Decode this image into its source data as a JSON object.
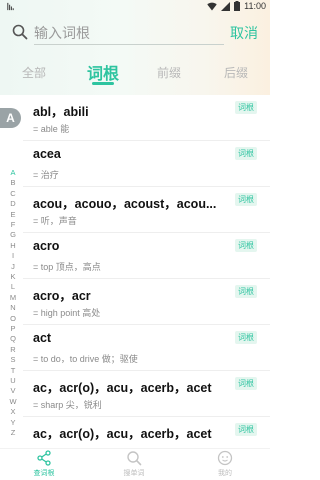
{
  "status_bar": {
    "time": "11:00"
  },
  "search": {
    "placeholder": "输入词根",
    "cancel_label": "取消"
  },
  "tabs": [
    {
      "label": "全部"
    },
    {
      "label": "词根"
    },
    {
      "label": "前缀"
    },
    {
      "label": "后缀"
    }
  ],
  "section": {
    "letter": "A"
  },
  "entries": [
    {
      "word": "abl，abili",
      "meaning": "= able 能",
      "badge": "词根"
    },
    {
      "word": "acea",
      "meaning": "= 治疗",
      "badge": "词根"
    },
    {
      "word": "acou，acouo，acoust，acou...",
      "meaning": "= 听，声音",
      "badge": "词根"
    },
    {
      "word": "acro",
      "meaning": "= top 顶点，高点",
      "badge": "词根"
    },
    {
      "word": "acro，acr",
      "meaning": "= high point 高处",
      "badge": "词根"
    },
    {
      "word": "act",
      "meaning": "= to do，to drive 做；驱使",
      "badge": "词根"
    },
    {
      "word": "ac，acr(o)，acu，acerb，acet",
      "meaning": "= sharp 尖，锐利",
      "badge": "词根"
    },
    {
      "word": "ac，acr(o)，acu，acerb，acet",
      "meaning": "",
      "badge": "词根"
    }
  ],
  "alphabet": [
    "A",
    "B",
    "C",
    "D",
    "E",
    "F",
    "G",
    "H",
    "I",
    "J",
    "K",
    "L",
    "M",
    "N",
    "O",
    "P",
    "Q",
    "R",
    "S",
    "T",
    "U",
    "V",
    "W",
    "X",
    "Y",
    "Z"
  ],
  "bottom_nav": [
    {
      "label": "查词根",
      "icon": "share-nodes-icon",
      "active": true
    },
    {
      "label": "搜单词",
      "icon": "search-icon",
      "active": false
    },
    {
      "label": "我的",
      "icon": "face-icon",
      "active": false
    }
  ],
  "colors": {
    "accent": "#2ec4a0",
    "section_bg": "#9aa3a6",
    "badge_bg": "#e4f6ef"
  }
}
